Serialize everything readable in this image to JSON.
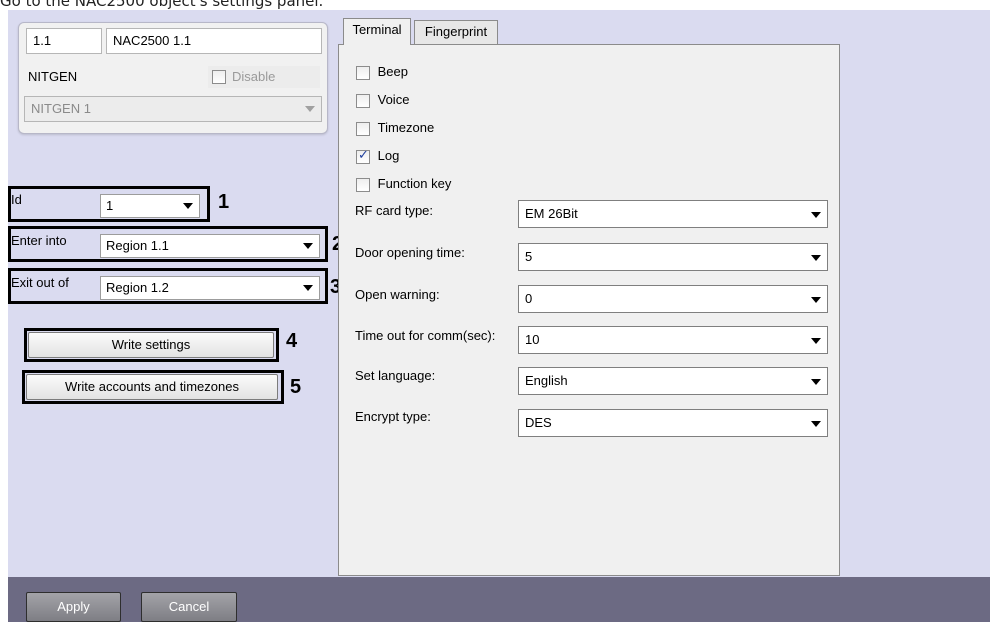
{
  "caption": "Go to the NAC2500 object's settings panel.",
  "object": {
    "id_value": "1.1",
    "name_value": "NAC2500 1.1",
    "vendor_label": "NITGEN",
    "disable_label": "Disable",
    "device_value": "NITGEN 1"
  },
  "left_settings": {
    "id_label": "Id",
    "id_value": "1",
    "enter_label": "Enter into",
    "enter_value": "Region 1.1",
    "exit_label": "Exit out of",
    "exit_value": "Region 1.2",
    "write_settings_label": "Write settings",
    "write_accounts_label": "Write accounts and timezones"
  },
  "callouts": [
    "1",
    "2",
    "3",
    "4",
    "5"
  ],
  "tabs": [
    {
      "label": "Terminal",
      "active": true
    },
    {
      "label": "Fingerprint",
      "active": false
    }
  ],
  "terminal": {
    "checkboxes": [
      {
        "label": "Beep",
        "checked": false
      },
      {
        "label": "Voice",
        "checked": false
      },
      {
        "label": "Timezone",
        "checked": false
      },
      {
        "label": "Log",
        "checked": true
      },
      {
        "label": "Function key",
        "checked": false
      }
    ],
    "rows": [
      {
        "label": "RF card type:",
        "value": "EM 26Bit"
      },
      {
        "label": "Door opening time:",
        "value": "5"
      },
      {
        "label": "Open warning:",
        "value": "0"
      },
      {
        "label": "Time out for comm(sec):",
        "value": "10"
      },
      {
        "label": "Set language:",
        "value": "English"
      },
      {
        "label": "Encrypt type:",
        "value": "DES"
      }
    ]
  },
  "footer": {
    "apply_label": "Apply",
    "cancel_label": "Cancel"
  },
  "colors": {
    "panel_background": "#dadbf0",
    "footer_background": "#6c6a83",
    "checkmark": "#1f3f9e"
  }
}
